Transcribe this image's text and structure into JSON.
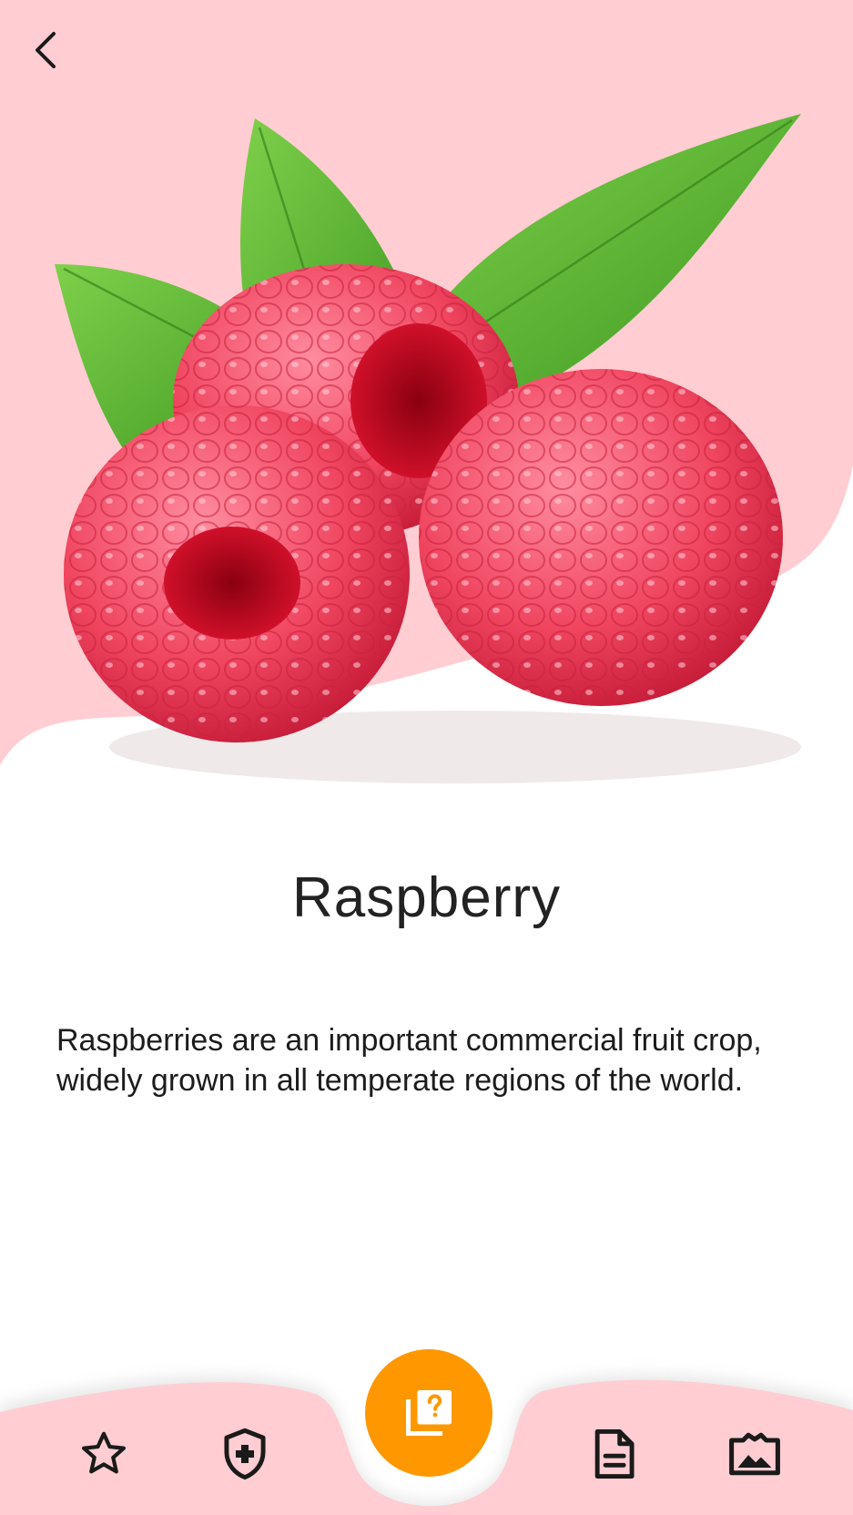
{
  "header": {
    "back_icon": "chevron-left-icon"
  },
  "hero": {
    "image_name": "raspberry-image"
  },
  "fruit": {
    "name": "Raspberry",
    "description": "Raspberries are an important commercial fruit crop, widely grown in all temperate regions of the world."
  },
  "bottom_nav": {
    "items": [
      {
        "icon": "star-icon"
      },
      {
        "icon": "shield-plus-icon"
      },
      {
        "icon": "quiz-icon"
      },
      {
        "icon": "document-icon"
      },
      {
        "icon": "gallery-icon"
      }
    ]
  },
  "colors": {
    "hero_background": "#ffcdd2",
    "nav_background": "#ffcdd2",
    "fab": "#ff9800",
    "text": "#222222"
  }
}
